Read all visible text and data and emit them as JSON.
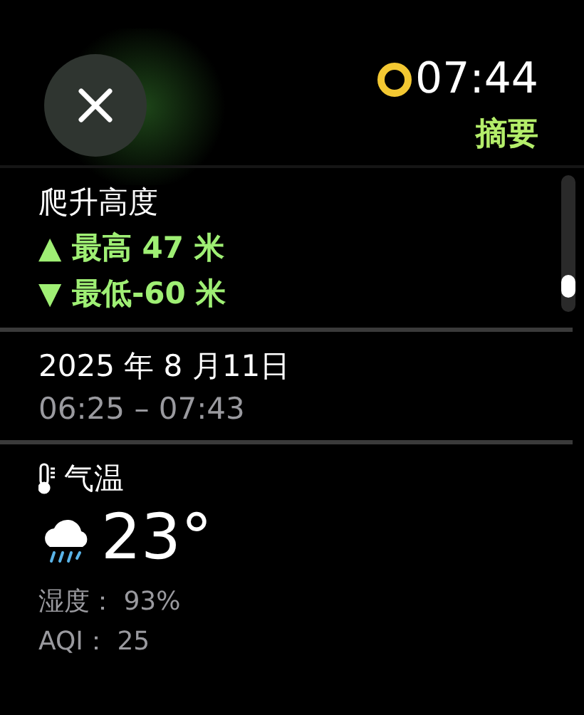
{
  "status": {
    "time": "07:44",
    "title": "摘要"
  },
  "elevation": {
    "label": "爬升高度",
    "high": "▲ 最高 47 米",
    "low": "▼ 最低-60 米"
  },
  "session": {
    "date": "2025 年 8 月11日",
    "range": "06:25 – 07:43"
  },
  "weather": {
    "label": "气温",
    "temperature": "23°",
    "humidity": "湿度： 93%",
    "aqi": "AQI： 25"
  }
}
